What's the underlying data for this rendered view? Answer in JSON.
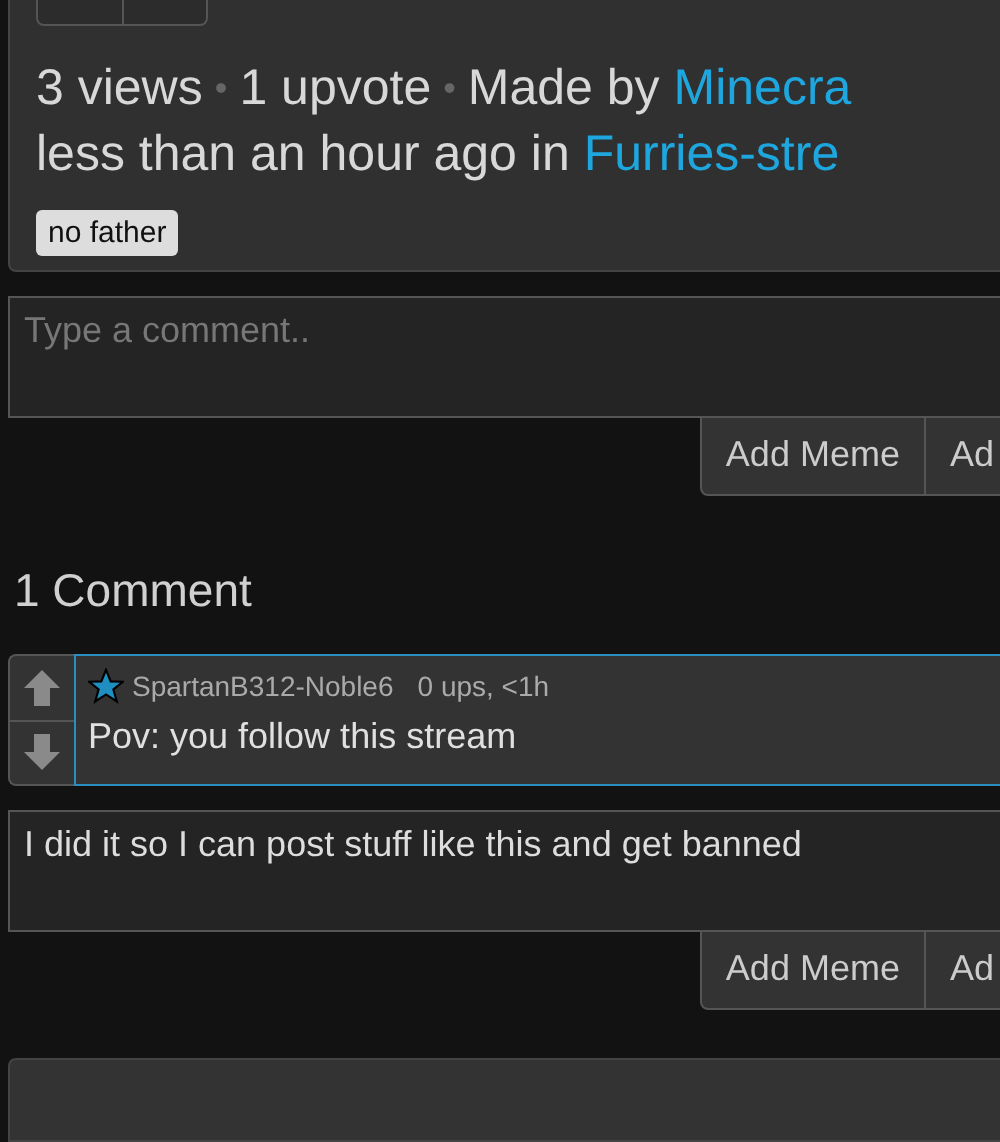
{
  "post": {
    "lines": [
      [
        {
          "kind": "text",
          "text": "3 views"
        },
        {
          "kind": "dot",
          "text": "•"
        },
        {
          "kind": "text",
          "text": "1 upvote"
        },
        {
          "kind": "dot",
          "text": "•"
        },
        {
          "kind": "text",
          "text": "Made by"
        },
        {
          "kind": "link",
          "text": "Minecra"
        }
      ],
      [
        {
          "kind": "text",
          "text": "less than an hour ago in"
        },
        {
          "kind": "link",
          "text": "Furries-stre"
        }
      ]
    ],
    "tags": [
      "no father"
    ]
  },
  "comment_box": {
    "placeholder": "Type a comment..",
    "buttons": [
      "Add Meme",
      "Ad"
    ]
  },
  "comments_heading": "1 Comment",
  "comments": [
    {
      "username": "SpartanB312-Noble6",
      "meta": "0 ups, <1h",
      "text": "Pov: you follow this stream"
    }
  ],
  "reply_box": {
    "value": "I did it so I can post stuff like this and get banned",
    "buttons": [
      "Add Meme",
      "Ad"
    ]
  }
}
